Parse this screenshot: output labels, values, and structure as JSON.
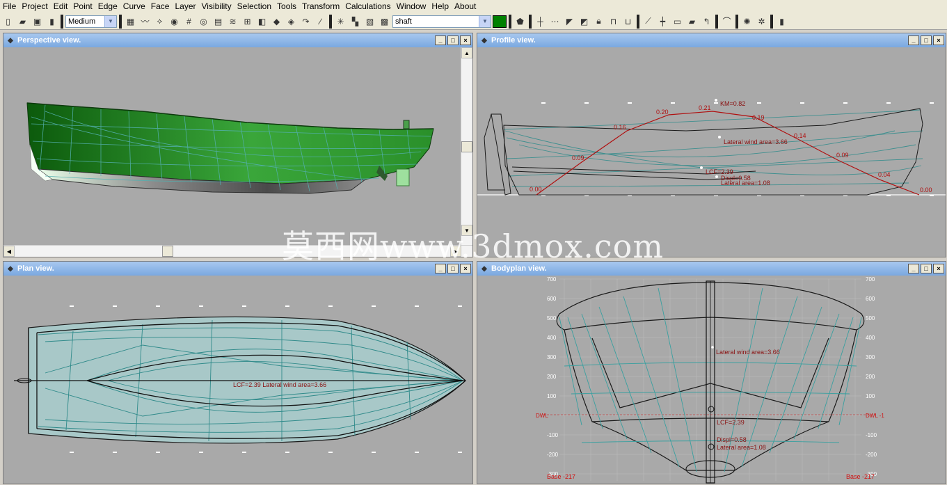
{
  "menu": [
    "File",
    "Project",
    "Edit",
    "Point",
    "Edge",
    "Curve",
    "Face",
    "Layer",
    "Visibility",
    "Selection",
    "Tools",
    "Transform",
    "Calculations",
    "Window",
    "Help",
    "About"
  ],
  "toolbar": {
    "precision_value": "Medium",
    "layer_value": "shaft",
    "layer_color": "#008000"
  },
  "windows": {
    "perspective": {
      "title": "Perspective view."
    },
    "profile": {
      "title": "Profile view.",
      "curve_labels": [
        "0.00",
        "0.09",
        "0.16",
        "0.20",
        "0.21",
        "0.19",
        "0.14",
        "0.09",
        "0.04",
        "0.00"
      ],
      "km_label": "KM=0.82",
      "wind_label": "Lateral wind area=3.66",
      "lcf_label": "LCF=2.39",
      "displ_label": "Displ=0.58",
      "lateral_label": "Lateral area=1.08"
    },
    "plan": {
      "title": "Plan view.",
      "overlap_label": "LCF=2.39 Lateral wind area=3.66"
    },
    "bodyplan": {
      "title": "Bodyplan view.",
      "left_ticks": [
        "700",
        "600",
        "500",
        "400",
        "300",
        "200",
        "100",
        "DWL",
        "-100",
        "-200",
        "-300"
      ],
      "right_ticks": [
        "700",
        "600",
        "500",
        "400",
        "300",
        "200",
        "100",
        "DWL -1",
        "-100",
        "-200",
        "-300"
      ],
      "base_left": "Base -217",
      "base_right": "Base -217",
      "wind_label": "Lateral wind area=3.66",
      "lcf_label": "LCF=2.39",
      "displ_label": "Displ=0.58",
      "lateral_label": "Lateral area=1.08"
    }
  },
  "watermark": "莫西网www.3dmox.com",
  "colors": {
    "hull_green": "#1f8a1f",
    "mesh": "#3c9a9a",
    "curve": "#b01010"
  }
}
